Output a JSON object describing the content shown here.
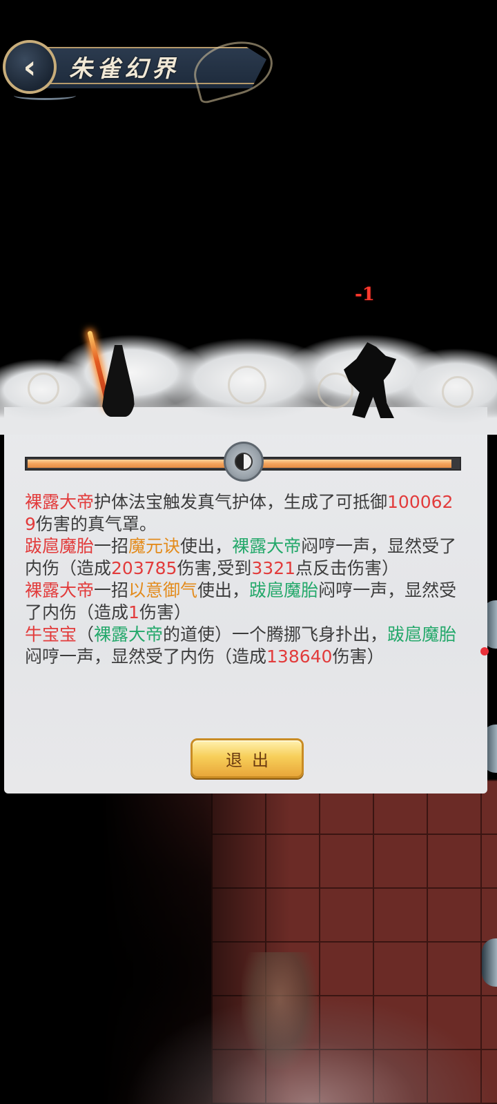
{
  "header": {
    "title": "朱雀幻界"
  },
  "battle": {
    "damage_popup": "-1",
    "progress_fraction": 0.984
  },
  "log": [
    [
      {
        "t": "裸露大帝",
        "c": "red"
      },
      {
        "t": "护体法宝触发真气护体，生成了可抵御",
        "c": "plain"
      },
      {
        "t": "1000629",
        "c": "red"
      },
      {
        "t": "伤害的真气罩。",
        "c": "plain"
      }
    ],
    [
      {
        "t": "跋扈魔胎",
        "c": "red"
      },
      {
        "t": "一招",
        "c": "plain"
      },
      {
        "t": "魔元诀",
        "c": "orange"
      },
      {
        "t": "使出，",
        "c": "plain"
      },
      {
        "t": "裸露大帝",
        "c": "green"
      },
      {
        "t": "闷哼一声，显然受了内伤（造成",
        "c": "plain"
      },
      {
        "t": "203785",
        "c": "red"
      },
      {
        "t": "伤害,受到",
        "c": "plain"
      },
      {
        "t": "3321",
        "c": "red"
      },
      {
        "t": "点反击伤害）",
        "c": "plain"
      }
    ],
    [
      {
        "t": "裸露大帝",
        "c": "red"
      },
      {
        "t": "一招",
        "c": "plain"
      },
      {
        "t": "以意御气",
        "c": "orange"
      },
      {
        "t": "使出，",
        "c": "plain"
      },
      {
        "t": "跋扈魔胎",
        "c": "green"
      },
      {
        "t": "闷哼一声，显然受了内伤（造成",
        "c": "plain"
      },
      {
        "t": "1",
        "c": "red"
      },
      {
        "t": "伤害）",
        "c": "plain"
      }
    ],
    [
      {
        "t": "牛宝宝",
        "c": "red"
      },
      {
        "t": "（",
        "c": "plain"
      },
      {
        "t": "裸露大帝",
        "c": "green"
      },
      {
        "t": "的道使）一个腾挪飞身扑出，",
        "c": "plain"
      },
      {
        "t": "跋扈魔胎",
        "c": "green"
      },
      {
        "t": "闷哼一声，显然受了内伤（造成",
        "c": "plain"
      },
      {
        "t": "138640",
        "c": "red"
      },
      {
        "t": "伤害）",
        "c": "plain"
      }
    ]
  ],
  "buttons": {
    "exit_label": "退出"
  },
  "icons": {
    "back": "chevron-left-icon",
    "divider": "yin-yang-icon"
  },
  "colors": {
    "player_name": "#e23b3b",
    "target_name": "#23a86a",
    "skill_name": "#e38b1c",
    "damage_number": "#e23b3b",
    "damage_popup": "#ff3a2e",
    "exit_button": "#f7cf5a"
  }
}
